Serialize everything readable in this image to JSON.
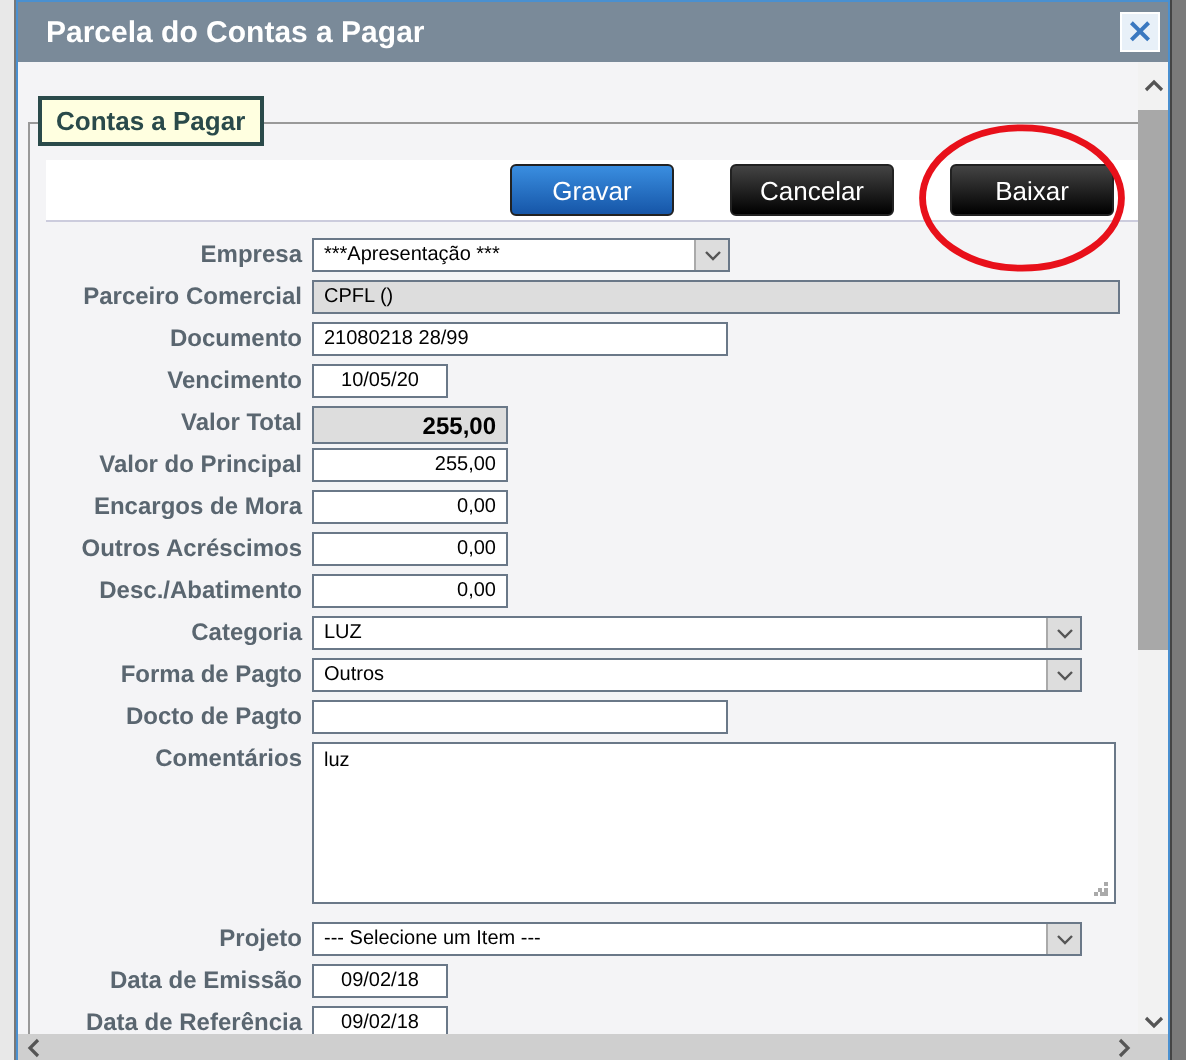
{
  "window": {
    "title": "Parcela do Contas a Pagar",
    "close": "×"
  },
  "fieldset": {
    "legend": "Contas a Pagar"
  },
  "buttons": [
    {
      "label": "Gravar",
      "kind": "primary"
    },
    {
      "label": "Cancelar",
      "kind": "dark"
    },
    {
      "label": "Baixar",
      "kind": "dark",
      "circled": true
    }
  ],
  "fields": [
    {
      "label": "Empresa",
      "kind": "select-narrow",
      "value": "***Apresentação ***"
    },
    {
      "label": "Parceiro Comercial",
      "kind": "readonly",
      "value": "CPFL ()"
    },
    {
      "label": "Documento",
      "kind": "text",
      "value": "21080218 28/99"
    },
    {
      "label": "Vencimento",
      "kind": "date",
      "value": "10/05/20"
    },
    {
      "label": "Valor Total",
      "kind": "total",
      "value": "255,00"
    },
    {
      "label": "Valor do Principal",
      "kind": "amount",
      "value": "255,00"
    },
    {
      "label": "Encargos de Mora",
      "kind": "amount",
      "value": "0,00"
    },
    {
      "label": "Outros Acréscimos",
      "kind": "amount",
      "value": "0,00"
    },
    {
      "label": "Desc./Abatimento",
      "kind": "amount",
      "value": "0,00"
    },
    {
      "label": "Categoria",
      "kind": "select",
      "value": "LUZ"
    },
    {
      "label": "Forma de Pagto",
      "kind": "select",
      "value": "Outros"
    },
    {
      "label": "Docto de Pagto",
      "kind": "text"
    },
    {
      "label": "Comentários",
      "kind": "textarea",
      "value": "luz"
    },
    {
      "label": "Projeto",
      "kind": "select",
      "value": "--- Selecione um Item ---"
    },
    {
      "label": "Data de Emissão",
      "kind": "date",
      "value": "09/02/18"
    },
    {
      "label": "Data de Referência",
      "kind": "date",
      "value": "09/02/18"
    }
  ]
}
